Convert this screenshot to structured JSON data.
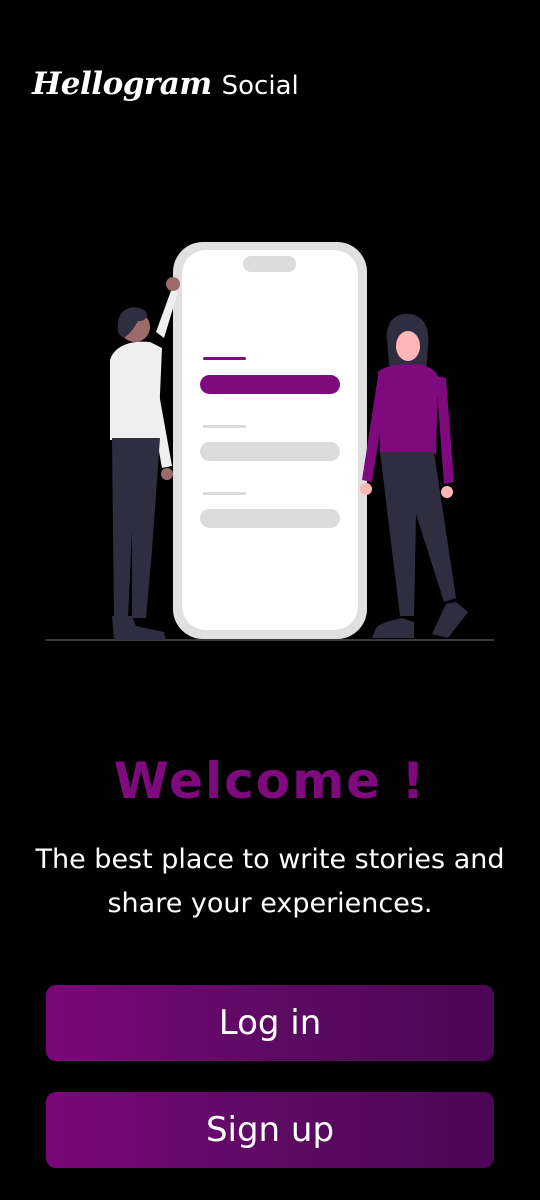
{
  "brand": {
    "name": "Hellogram",
    "suffix": "Social"
  },
  "welcome": {
    "title": "Welcome !",
    "tagline": "The best place to write stories and share your experiences."
  },
  "actions": {
    "login_label": "Log in",
    "signup_label": "Sign up"
  },
  "colors": {
    "background": "#000000",
    "accent": "#7e0a7e",
    "button_gradient_start": "#7a077a",
    "button_gradient_end": "#4b0654"
  },
  "illustration": {
    "icon": "people-with-phone-illustration"
  }
}
